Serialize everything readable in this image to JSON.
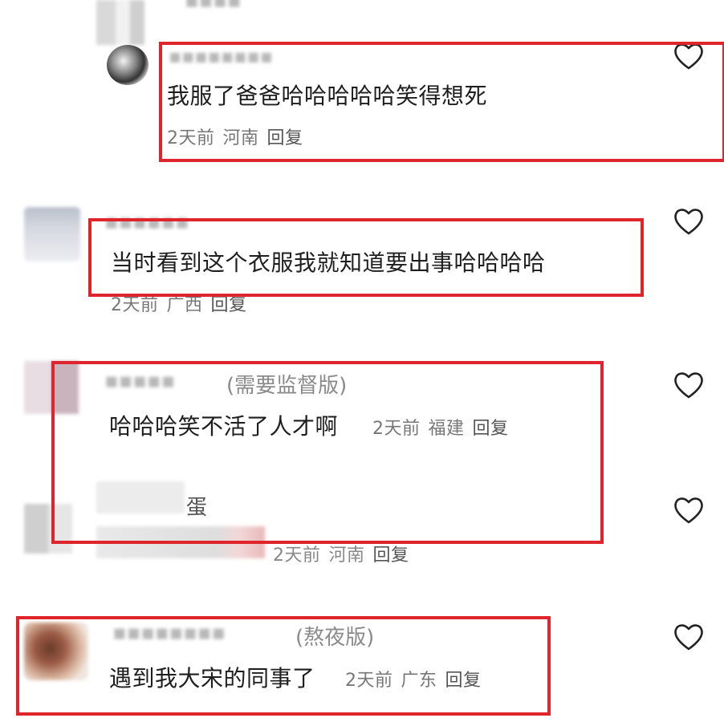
{
  "comments": [
    {
      "username_fragment": "",
      "text": "我服了爸爸哈哈哈哈哈笑得想死",
      "time": "2天前",
      "region": "河南",
      "reply_label": "回复"
    },
    {
      "text": "当时看到这个衣服我就知道要出事哈哈哈哈",
      "time": "2天前",
      "region": "广西",
      "reply_label": "回复"
    },
    {
      "username_suffix": "(需要监督版)",
      "text": "哈哈哈笑不活了人才啊",
      "time": "2天前",
      "region": "福建",
      "reply_label": "回复"
    },
    {
      "username_fragment": "蛋",
      "time": "2天前",
      "region": "河南",
      "reply_label": "回复"
    },
    {
      "username_suffix": "(熬夜版)",
      "text": "遇到我大宋的同事了",
      "time": "2天前",
      "region": "广东",
      "reply_label": "回复"
    }
  ],
  "icons": {
    "like": "heart-outline-icon"
  },
  "colors": {
    "highlight_box": "#e0242c",
    "meta_text": "#777777"
  }
}
